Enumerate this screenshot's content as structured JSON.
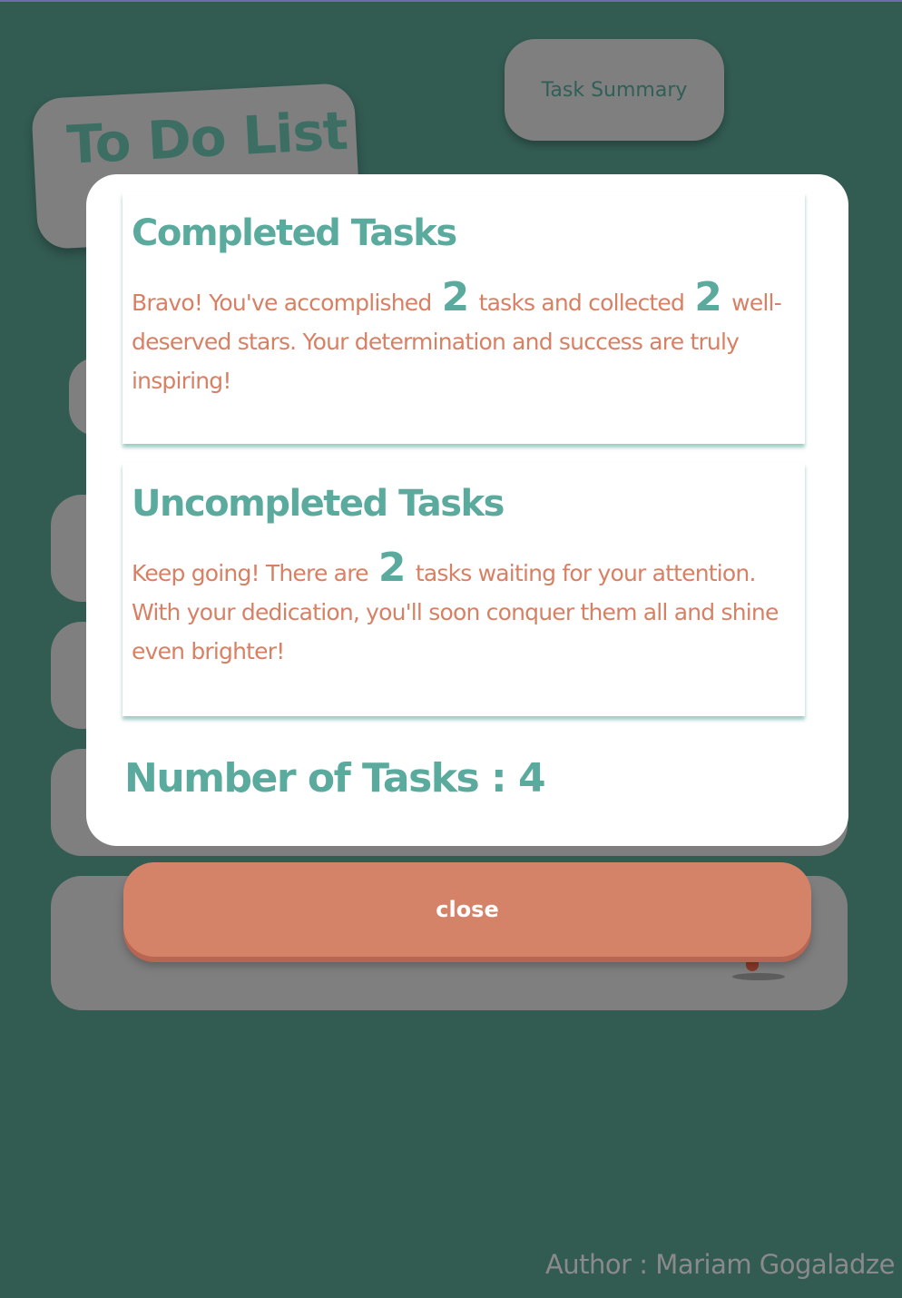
{
  "background": {
    "app_title": "To Do List",
    "summary_button_label": "Task Summary"
  },
  "modal": {
    "completed": {
      "heading": "Completed Tasks",
      "text_1": "Bravo! You've accomplished",
      "count_tasks": "2",
      "text_2": "tasks and collected",
      "count_stars": "2",
      "text_3": "well-deserved stars. Your determination and success are truly inspiring!"
    },
    "uncompleted": {
      "heading": "Uncompleted Tasks",
      "text_1": "Keep going! There are",
      "count_tasks": "2",
      "text_2": "tasks waiting for your attention. With your dedication, you'll soon conquer them all and shine even brighter!"
    },
    "total_label": "Number of Tasks : 4",
    "close_label": "close"
  },
  "footer": {
    "author": "Author : Mariam Gogaladze"
  },
  "colors": {
    "page_bg": "#325b52",
    "overlay_gray": "#7f7f7f",
    "teal": "#5aaa9d",
    "coral": "#d88064",
    "button": "#d48268"
  }
}
